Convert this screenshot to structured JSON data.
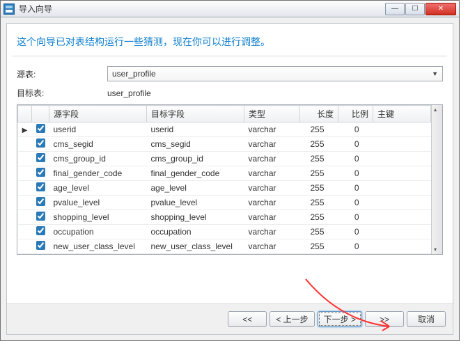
{
  "titlebar": {
    "title": "导入向导"
  },
  "winbtns": {
    "min": "—",
    "max": "☐",
    "close": "✕"
  },
  "heading": "这个向导已对表结构运行一些猜测，现在你可以进行调整。",
  "form": {
    "source_label": "源表:",
    "source_value": "user_profile",
    "target_label": "目标表:",
    "target_value": "user_profile"
  },
  "grid": {
    "headers": {
      "source": "源字段",
      "target": "目标字段",
      "type": "类型",
      "length": "长度",
      "scale": "比例",
      "pk": "主键"
    },
    "rows": [
      {
        "mark": "▶",
        "checked": true,
        "source": "userid",
        "target": "userid",
        "type": "varchar",
        "length": 255,
        "scale": 0
      },
      {
        "mark": "",
        "checked": true,
        "source": "cms_segid",
        "target": "cms_segid",
        "type": "varchar",
        "length": 255,
        "scale": 0
      },
      {
        "mark": "",
        "checked": true,
        "source": "cms_group_id",
        "target": "cms_group_id",
        "type": "varchar",
        "length": 255,
        "scale": 0
      },
      {
        "mark": "",
        "checked": true,
        "source": "final_gender_code",
        "target": "final_gender_code",
        "type": "varchar",
        "length": 255,
        "scale": 0
      },
      {
        "mark": "",
        "checked": true,
        "source": "age_level",
        "target": "age_level",
        "type": "varchar",
        "length": 255,
        "scale": 0
      },
      {
        "mark": "",
        "checked": true,
        "source": "pvalue_level",
        "target": "pvalue_level",
        "type": "varchar",
        "length": 255,
        "scale": 0
      },
      {
        "mark": "",
        "checked": true,
        "source": "shopping_level",
        "target": "shopping_level",
        "type": "varchar",
        "length": 255,
        "scale": 0
      },
      {
        "mark": "",
        "checked": true,
        "source": "occupation",
        "target": "occupation",
        "type": "varchar",
        "length": 255,
        "scale": 0
      },
      {
        "mark": "",
        "checked": true,
        "source": "new_user_class_level",
        "target": "new_user_class_level",
        "type": "varchar",
        "length": 255,
        "scale": 0
      }
    ]
  },
  "footer": {
    "first": "<<",
    "prev": "< 上一步",
    "next": "下一步 >",
    "last": ">>",
    "cancel": "取消"
  }
}
